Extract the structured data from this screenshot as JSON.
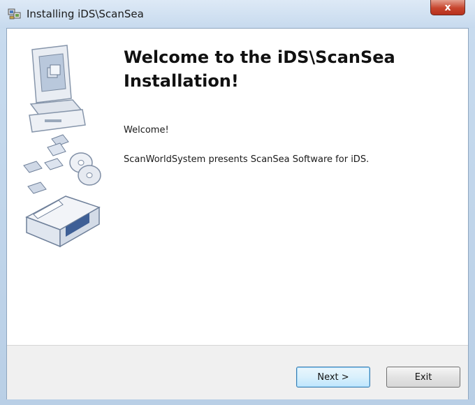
{
  "window": {
    "title": "Installing iDS\\ScanSea",
    "close_label": "x"
  },
  "main": {
    "heading": "Welcome to the iDS\\ScanSea Installation!",
    "welcome_text": "Welcome!",
    "description": "ScanWorldSystem presents ScanSea Software for iDS."
  },
  "buttons": {
    "next": "Next >",
    "exit": "Exit"
  },
  "icons": {
    "app": "installer-app-icon",
    "artwork": "computer-setup-illustration"
  }
}
